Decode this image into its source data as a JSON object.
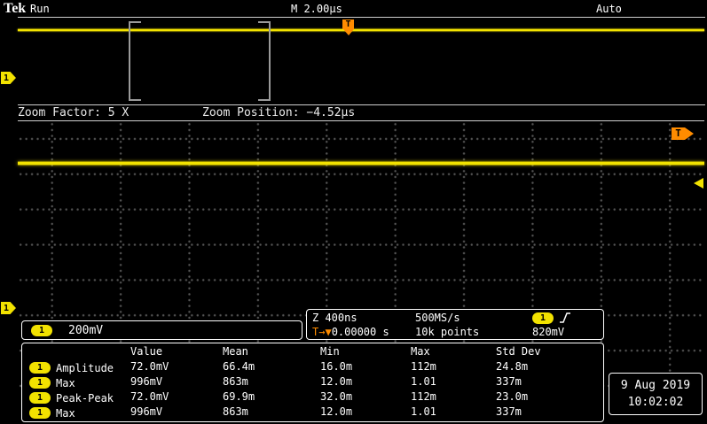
{
  "top_bar": {
    "logo": "Tek",
    "acq_state": "Run",
    "timebase": "M 2.00µs",
    "trigger_mode": "Auto"
  },
  "markers": {
    "channel": "1",
    "trigger": "T"
  },
  "zoom_bar": {
    "factor": "Zoom Factor: 5 X",
    "position": "Zoom Position: −4.52µs"
  },
  "ch1_box": {
    "channel": "1",
    "scale": "200mV"
  },
  "acq_box": {
    "zoom_scale": "Z 400ns",
    "sample_rate": "500MS/s",
    "trig_source": "1",
    "trig_prefix": "T→▼",
    "trig_position": "0.00000 s",
    "record_length": "10k points",
    "trig_level": "820mV"
  },
  "measurements": {
    "headers": [
      "Value",
      "Mean",
      "Min",
      "Max",
      "Std Dev"
    ],
    "rows": [
      {
        "channel": "1",
        "name": "Amplitude",
        "value": "72.0mV",
        "mean": "66.4m",
        "min": "16.0m",
        "max": "112m",
        "std": "24.8m"
      },
      {
        "channel": "1",
        "name": "Max",
        "value": "996mV",
        "mean": "863m",
        "min": "12.0m",
        "max": "1.01",
        "std": "337m"
      },
      {
        "channel": "1",
        "name": "Peak-Peak",
        "value": "72.0mV",
        "mean": "69.9m",
        "min": "32.0m",
        "max": "112m",
        "std": "23.0m"
      },
      {
        "channel": "1",
        "name": "Max",
        "value": "996mV",
        "mean": "863m",
        "min": "12.0m",
        "max": "1.01",
        "std": "337m"
      }
    ]
  },
  "datetime": {
    "date": "9 Aug 2019",
    "time": "10:02:02"
  },
  "colors": {
    "ch1": "#f2e200",
    "trigger": "#ff8c00",
    "grid_dot": "#565656"
  }
}
